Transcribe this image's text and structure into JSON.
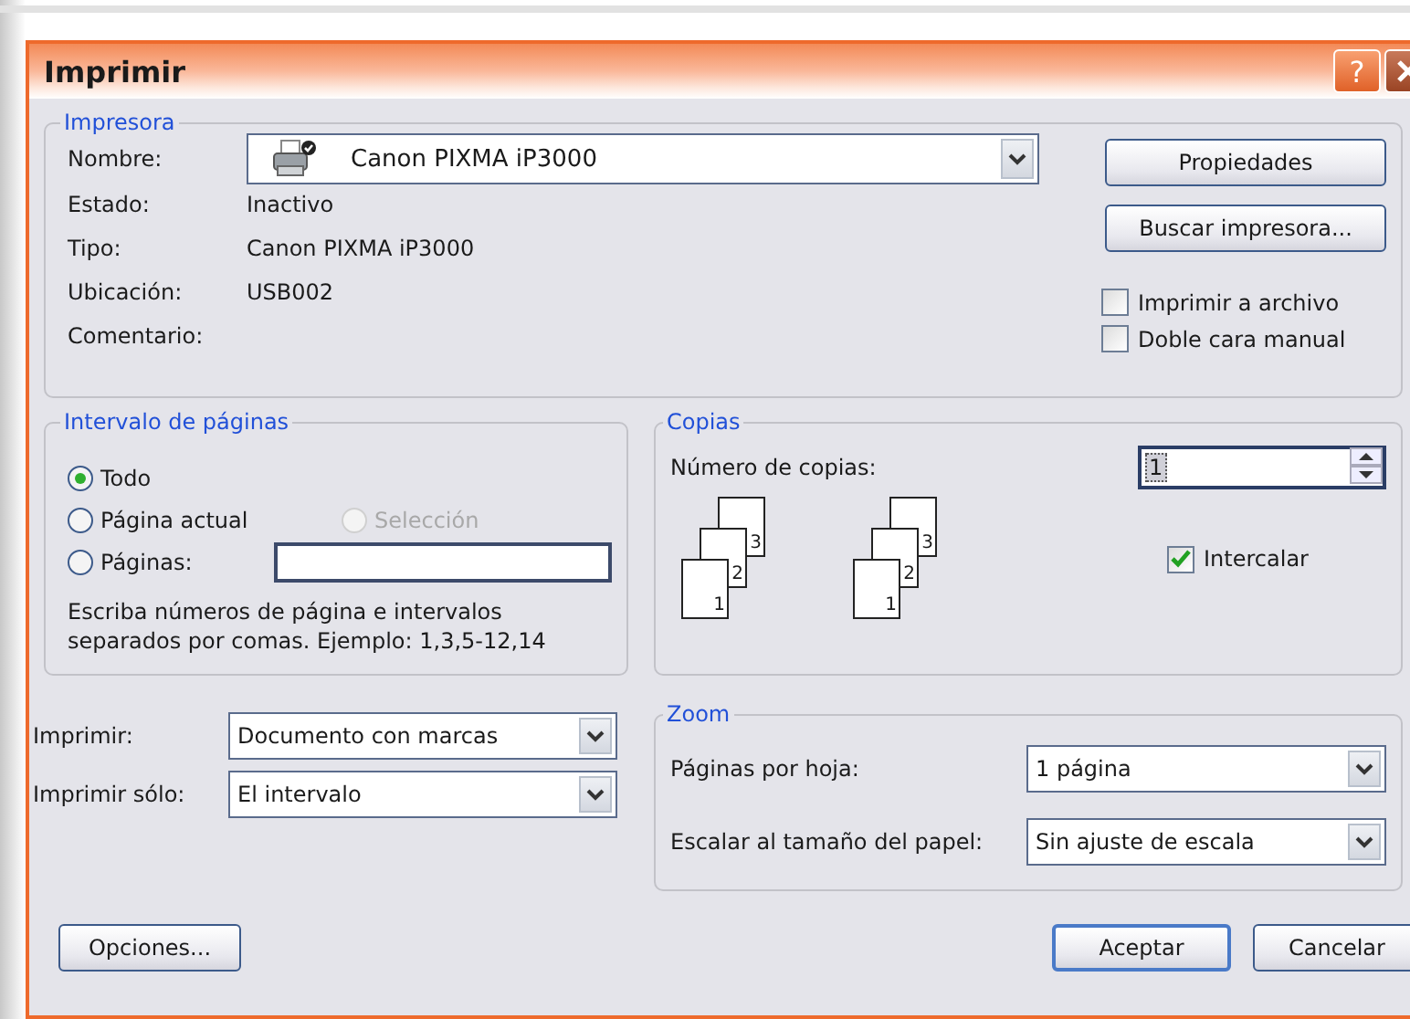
{
  "window": {
    "title": "Imprimir",
    "help": "?"
  },
  "printer": {
    "legend": "Impresora",
    "name_label": "Nombre:",
    "name_value": "Canon PIXMA iP3000",
    "fields": [
      {
        "label": "Estado:",
        "value": "Inactivo"
      },
      {
        "label": "Tipo:",
        "value": "Canon PIXMA iP3000"
      },
      {
        "label": "Ubicación:",
        "value": "USB002"
      },
      {
        "label": "Comentario:"
      }
    ],
    "buttons": [
      "Propiedades",
      "Buscar impresora..."
    ],
    "options": [
      {
        "label": "Imprimir a archivo",
        "checked": false
      },
      {
        "label": "Doble cara manual",
        "checked": false
      }
    ]
  },
  "page_range": {
    "legend": "Intervalo de páginas",
    "options": [
      {
        "label": "Todo",
        "selected": true,
        "disabled": false
      },
      {
        "label": "Página actual",
        "selected": false,
        "disabled": false
      },
      {
        "label": "Selección",
        "selected": false,
        "disabled": true
      },
      {
        "label": "Páginas:",
        "selected": false,
        "disabled": false
      }
    ],
    "hint": "Escriba números de página e intervalos separados por comas. Ejemplo: 1,3,5-12,14"
  },
  "copies": {
    "legend": "Copias",
    "label": "Número de copias:",
    "value": "1",
    "stacks": [
      {
        "pages": [
          "3",
          "2",
          "1"
        ]
      },
      {
        "pages": [
          "3",
          "2",
          "1"
        ]
      }
    ],
    "collate": {
      "label": "Intercalar",
      "checked": true
    }
  },
  "print_what": [
    {
      "label": "Imprimir:",
      "value": "Documento con marcas"
    },
    {
      "label": "Imprimir sólo:",
      "value": "El intervalo"
    }
  ],
  "zoom": {
    "legend": "Zoom",
    "rows": [
      {
        "label": "Páginas por hoja:",
        "value": "1 página"
      },
      {
        "label": "Escalar al tamaño del papel:",
        "value": "Sin ajuste de escala"
      }
    ]
  },
  "buttons": [
    {
      "label": "Opciones...",
      "default": false
    },
    {
      "label": "Aceptar",
      "default": true
    },
    {
      "label": "Cancelar",
      "default": false
    }
  ]
}
